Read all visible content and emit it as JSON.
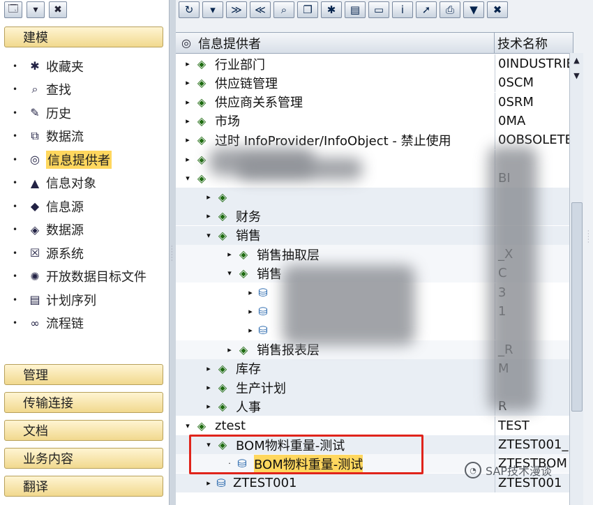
{
  "left_toolbar": {
    "items": [
      {
        "icon": "tree-config-icon",
        "glyph": "🗔"
      },
      {
        "icon": "dropdown-icon",
        "glyph": "▾"
      },
      {
        "icon": "close-icon",
        "glyph": "✖"
      }
    ]
  },
  "sections": {
    "modeling": "建模",
    "admin": "管理",
    "transport": "传输连接",
    "docs": "文档",
    "bc": "业务内容",
    "translate": "翻译"
  },
  "nav": [
    {
      "label": "收藏夹",
      "icon": "favorites-icon",
      "glyph": "✱"
    },
    {
      "label": "查找",
      "icon": "binoculars-icon",
      "glyph": "⌕"
    },
    {
      "label": "历史",
      "icon": "history-icon",
      "glyph": "✎"
    },
    {
      "label": "数据流",
      "icon": "dataflow-icon",
      "glyph": "⧉"
    },
    {
      "label": "信息提供者",
      "icon": "infoprovider-icon",
      "glyph": "◎",
      "selected": true
    },
    {
      "label": "信息对象",
      "icon": "infoobject-icon",
      "glyph": "▲"
    },
    {
      "label": "信息源",
      "icon": "infosource-icon",
      "glyph": "◆"
    },
    {
      "label": "数据源",
      "icon": "datasource-icon",
      "glyph": "◈"
    },
    {
      "label": "源系统",
      "icon": "source-system-icon",
      "glyph": "☒"
    },
    {
      "label": "开放数据目标文件",
      "icon": "open-hub-icon",
      "glyph": "✺"
    },
    {
      "label": "计划序列",
      "icon": "process-variant-icon",
      "glyph": "▤"
    },
    {
      "label": "流程链",
      "icon": "process-chain-icon",
      "glyph": "∞"
    }
  ],
  "right_toolbar": [
    {
      "icon": "refresh-icon",
      "glyph": "↻"
    },
    {
      "icon": "expand-icon",
      "glyph": "▾"
    },
    {
      "icon": "expand-all-icon",
      "glyph": "≫"
    },
    {
      "icon": "collapse-all-icon",
      "glyph": "≪"
    },
    {
      "icon": "binoculars-icon",
      "glyph": "⌕"
    },
    {
      "icon": "copy-icon",
      "glyph": "❐"
    },
    {
      "icon": "settings-icon",
      "glyph": "✱"
    },
    {
      "icon": "chart-icon",
      "glyph": "▤"
    },
    {
      "icon": "window-icon",
      "glyph": "▭"
    },
    {
      "icon": "info-icon",
      "glyph": "i"
    },
    {
      "icon": "pin-icon",
      "glyph": "➚"
    },
    {
      "icon": "print-icon",
      "glyph": "⎙"
    },
    {
      "icon": "filter-icon",
      "glyph": "▼"
    },
    {
      "icon": "close-icon",
      "glyph": "✖"
    }
  ],
  "table": {
    "header_icon": "infoprovider-icon",
    "col1": "信息提供者",
    "col2": "技术名称",
    "rows": [
      {
        "depth": 0,
        "tw": "▸",
        "icon": "node",
        "label": "行业部门",
        "tech": "0INDUSTRIE",
        "name": "tree-node"
      },
      {
        "depth": 0,
        "tw": "▸",
        "icon": "node",
        "label": "供应链管理",
        "tech": "0SCM",
        "name": "tree-node"
      },
      {
        "depth": 0,
        "tw": "▸",
        "icon": "node",
        "label": "供应商关系管理",
        "tech": "0SRM",
        "name": "tree-node"
      },
      {
        "depth": 0,
        "tw": "▸",
        "icon": "node",
        "label": "市场",
        "tech": "0MA",
        "name": "tree-node"
      },
      {
        "depth": 0,
        "tw": "▸",
        "icon": "node",
        "label": "过时 InfoProvider/InfoObject - 禁止使用",
        "tech": "0OBSOLETE",
        "name": "tree-node"
      },
      {
        "depth": 0,
        "tw": "▸",
        "icon": "node",
        "label": "",
        "tech": "",
        "name": "tree-node",
        "redacted": true
      },
      {
        "depth": 0,
        "tw": "▾",
        "icon": "node",
        "label": "",
        "tech": "BI",
        "name": "tree-node",
        "redacted": true
      },
      {
        "depth": 1,
        "tw": "▸",
        "icon": "node",
        "label": "",
        "tech": "",
        "name": "tree-node",
        "redacted": true
      },
      {
        "depth": 1,
        "tw": "▸",
        "icon": "node",
        "label": "财务",
        "tech": "",
        "name": "tree-node"
      },
      {
        "depth": 1,
        "tw": "▾",
        "icon": "node",
        "label": "销售",
        "tech": "",
        "name": "tree-node"
      },
      {
        "depth": 2,
        "tw": "▸",
        "icon": "node",
        "label": "销售抽取层",
        "tech": "_X",
        "name": "tree-node"
      },
      {
        "depth": 2,
        "tw": "▾",
        "icon": "node",
        "label": "销售",
        "tech": "C",
        "name": "tree-node"
      },
      {
        "depth": 3,
        "tw": "▸",
        "icon": "cube",
        "label": "",
        "tech": "3",
        "name": "tree-node",
        "redacted": true
      },
      {
        "depth": 3,
        "tw": "▸",
        "icon": "cube",
        "label": "",
        "tech": "1",
        "name": "tree-node",
        "redacted": true
      },
      {
        "depth": 3,
        "tw": "▸",
        "icon": "cube",
        "label": "",
        "tech": "",
        "name": "tree-node",
        "redacted": true
      },
      {
        "depth": 2,
        "tw": "▸",
        "icon": "node",
        "label": "销售报表层",
        "tech": "_R",
        "name": "tree-node"
      },
      {
        "depth": 1,
        "tw": "▸",
        "icon": "node",
        "label": "库存",
        "tech": "M",
        "name": "tree-node"
      },
      {
        "depth": 1,
        "tw": "▸",
        "icon": "node",
        "label": "生产计划",
        "tech": "",
        "name": "tree-node"
      },
      {
        "depth": 1,
        "tw": "▸",
        "icon": "node",
        "label": "人事",
        "tech": "R",
        "name": "tree-node"
      },
      {
        "depth": 0,
        "tw": "▾",
        "icon": "node",
        "label": "ztest",
        "tech": "TEST",
        "name": "tree-node"
      },
      {
        "depth": 1,
        "tw": "▾",
        "icon": "node",
        "label": "BOM物料重量-测试",
        "tech": "ZTEST001_",
        "name": "tree-node"
      },
      {
        "depth": 2,
        "tw": "·",
        "icon": "cube",
        "label": "BOM物料重量-测试",
        "tech": "ZTESTBOM",
        "name": "tree-node-selected",
        "highlight": true
      },
      {
        "depth": 1,
        "tw": "▸",
        "icon": "cube",
        "label": "ZTEST001",
        "tech": "ZTEST001",
        "name": "tree-node"
      }
    ]
  },
  "watermark": "SAP技术漫谈"
}
